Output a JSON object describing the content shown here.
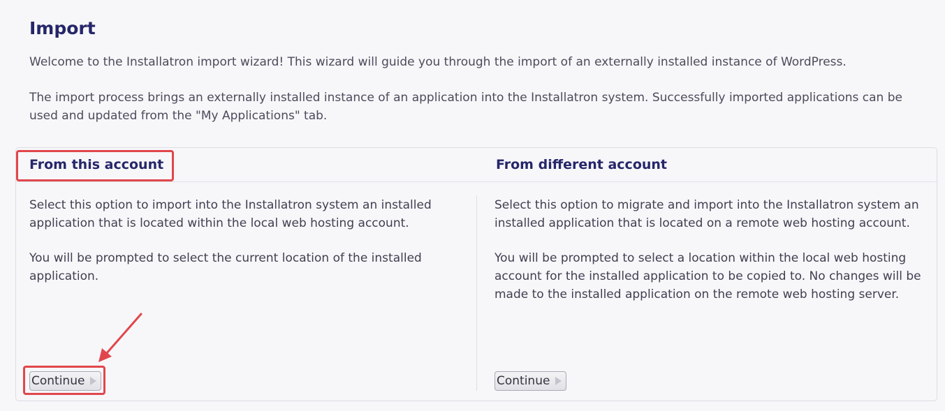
{
  "page": {
    "title": "Import",
    "intro_1": "Welcome to the Installatron import wizard! This wizard will guide you through the import of an externally installed instance of WordPress.",
    "intro_2": "The import process brings an externally installed instance of an application into the Installatron system. Successfully imported applications can be used and updated from the \"My Applications\" tab."
  },
  "options": {
    "this_account": {
      "title": "From this account",
      "text_1": "Select this option to import into the Installatron system an installed application that is located within the local web hosting account.",
      "text_2": "You will be prompted to select the current location of the installed application.",
      "button_label": "Continue"
    },
    "different_account": {
      "title": "From different account",
      "text_1": "Select this option to migrate and import into the Installatron system an installed application that is located on a remote web hosting account.",
      "text_2": "You will be prompted to select a location within the local web hosting account for the installed application to be copied to. No changes will be made to the installed application on the remote web hosting server.",
      "button_label": "Continue"
    }
  },
  "colors": {
    "title": "#26266a",
    "text": "#3f3f50",
    "annotation": "#e0474c",
    "background": "#f7f7f9"
  },
  "icons": {
    "button_arrow": "play-arrow-icon",
    "annotation_arrow": "pointer-arrow-icon"
  }
}
